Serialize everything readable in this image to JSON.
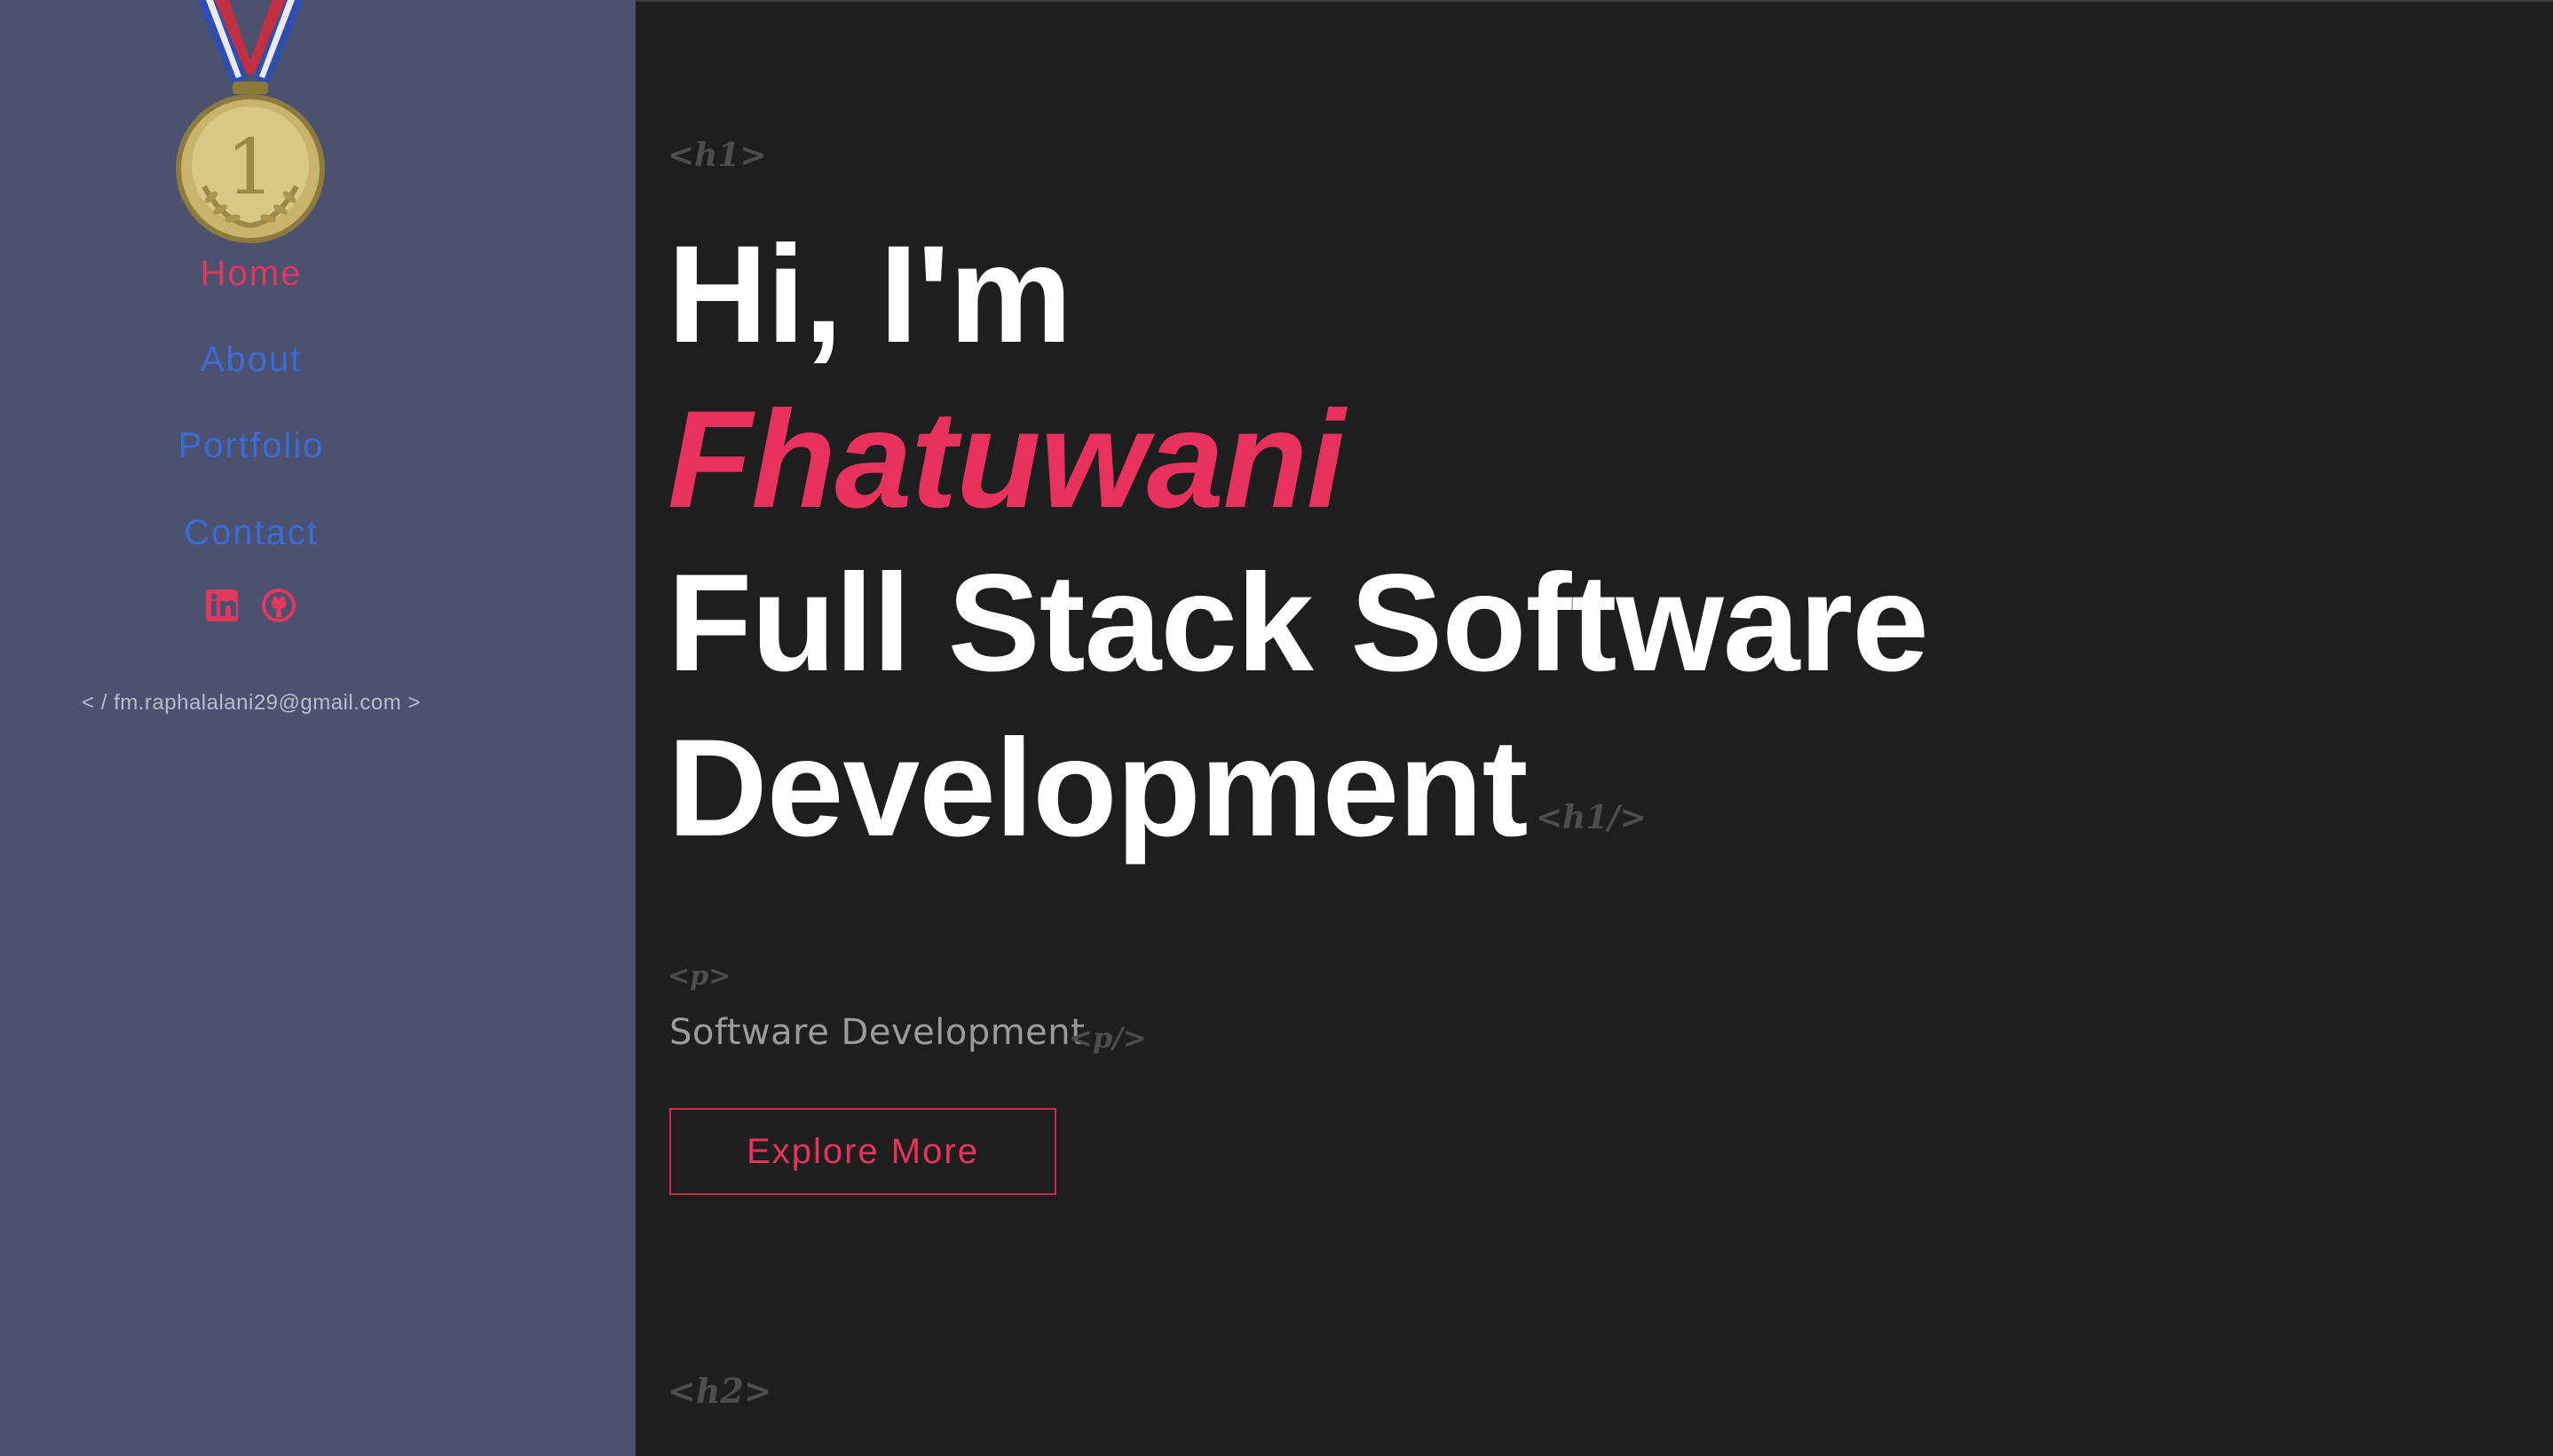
{
  "sidebar": {
    "logo_icon": "gold-medal-first-place-icon",
    "nav": {
      "home": "Home",
      "about": "About",
      "portfolio": "Portfolio",
      "contact": "Contact"
    },
    "socials": [
      {
        "icon": "linkedin-icon"
      },
      {
        "icon": "github-icon"
      }
    ],
    "email": "< / fm.raphalalani29@gmail.com >",
    "active_color": "#e0385e",
    "link_color": "#3b6bd6",
    "background": "#4b516e"
  },
  "main": {
    "tags": {
      "h1_open": "<h1>",
      "h1_close": "<h1/>",
      "p_open": "<p>",
      "p_close": "<p/>",
      "h2_open": "<h2>"
    },
    "headline": {
      "line1": "Hi, I'm",
      "line2": "Fhatuwani",
      "line3": "Full Stack Software",
      "line4": "Development"
    },
    "subtitle": "Software Development",
    "cta_label": "Explore More",
    "accent": "#e8325d",
    "background": "#1e1e1e"
  }
}
